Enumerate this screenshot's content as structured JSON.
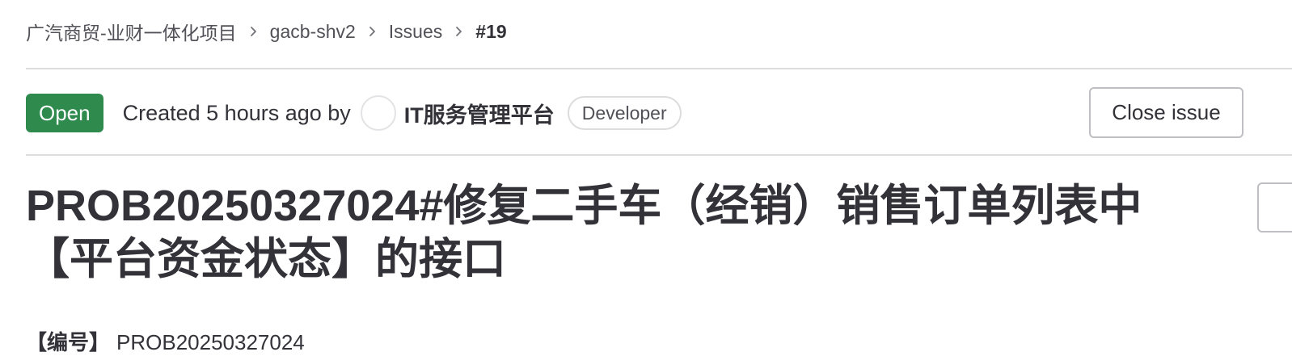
{
  "breadcrumb": {
    "group": "广汽商贸-业财一体化项目",
    "project": "gacb-shv2",
    "section": "Issues",
    "current": "#19"
  },
  "issue": {
    "status": "Open",
    "created_text": "Created 5 hours ago by",
    "author": "IT服务管理平台",
    "author_role": "Developer",
    "close_button": "Close issue",
    "title": "PROB20250327024#修复二手车（经销）销售订单列表中【平台资金状态】的接口"
  },
  "description": {
    "label": "【编号】",
    "value": "PROB20250327024"
  },
  "colors": {
    "status_open": "#2f8a4e",
    "text": "#333238",
    "muted": "#535158",
    "border": "#dcdcde"
  },
  "icons": {
    "breadcrumb_separator": "chevron-right-icon"
  }
}
